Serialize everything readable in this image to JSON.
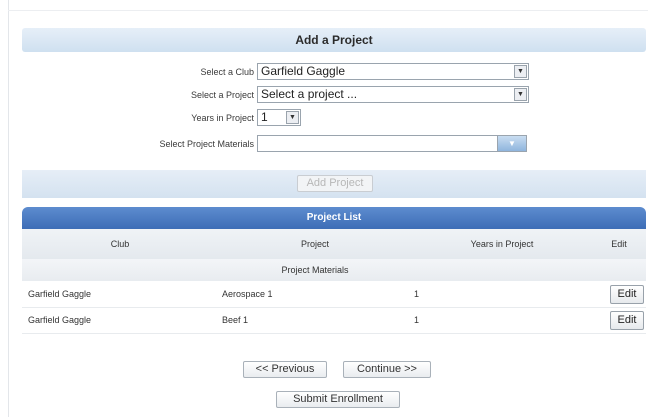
{
  "form": {
    "title": "Add a Project",
    "club_label": "Select a Club",
    "club_value": "Garfield Gaggle",
    "project_label": "Select a Project",
    "project_value": "Select a project ...",
    "years_label": "Years in Project",
    "years_value": "1",
    "materials_label": "Select Project Materials",
    "materials_value": "",
    "add_button": "Add Project"
  },
  "project_list": {
    "title": "Project List",
    "headers": {
      "club": "Club",
      "project": "Project",
      "years": "Years in Project",
      "edit": "Edit"
    },
    "subheader": "Project Materials",
    "rows": [
      {
        "club": "Garfield Gaggle",
        "project": "Aerospace 1",
        "years": "1",
        "edit": "Edit"
      },
      {
        "club": "Garfield Gaggle",
        "project": "Beef 1",
        "years": "1",
        "edit": "Edit"
      }
    ]
  },
  "nav": {
    "previous": "<< Previous",
    "continue": "Continue >>",
    "submit": "Submit Enrollment"
  },
  "icons": {
    "dropdown": "chevron-down-icon"
  }
}
